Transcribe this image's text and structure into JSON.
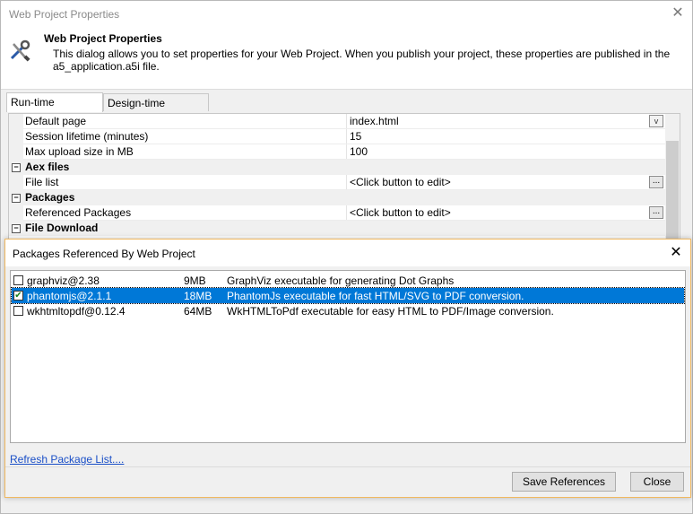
{
  "window": {
    "title": "Web Project Properties",
    "close_glyph": "✕"
  },
  "header": {
    "title": "Web Project Properties",
    "description_line1": "This dialog allows you to set properties for your Web Project. When you publish your project, these properties are published in the",
    "description_line2": "a5_application.a5i file.",
    "icon": "tools-icon"
  },
  "tabs": [
    {
      "label": "Run-time Properties",
      "active": true
    },
    {
      "label": "Design-time Properties",
      "active": false
    }
  ],
  "grid": {
    "rows": [
      {
        "type": "prop",
        "label": "Default page",
        "value": "index.html",
        "button": "dropdown"
      },
      {
        "type": "prop",
        "label": "Session lifetime (minutes)",
        "value": "15"
      },
      {
        "type": "prop",
        "label": "Max upload size in MB",
        "value": "100"
      },
      {
        "type": "category",
        "label": "Aex files"
      },
      {
        "type": "prop",
        "label": "File list",
        "value": "<Click button to edit>",
        "button": "ellipsis"
      },
      {
        "type": "category",
        "label": "Packages"
      },
      {
        "type": "prop",
        "label": "Referenced Packages",
        "value": "<Click button to edit>",
        "button": "ellipsis"
      },
      {
        "type": "category",
        "label": "File Download"
      }
    ],
    "ellipsis_glyph": "...",
    "dropdown_glyph": "v",
    "collapse_glyph": "−"
  },
  "modal": {
    "title": "Packages Referenced By Web Project",
    "close_glyph": "✕",
    "packages": [
      {
        "name": "graphviz@2.38",
        "size": "9MB",
        "description": "GraphViz executable for generating Dot Graphs",
        "checked": false,
        "selected": false
      },
      {
        "name": "phantomjs@2.1.1",
        "size": "18MB",
        "description": "PhantomJs executable for fast HTML/SVG to PDF conversion.",
        "checked": true,
        "selected": true
      },
      {
        "name": "wkhtmltopdf@0.12.4",
        "size": "64MB",
        "description": "WkHTMLToPdf executable for easy HTML to PDF/Image conversion.",
        "checked": false,
        "selected": false
      }
    ],
    "checkmark_glyph": "✔",
    "refresh_link": "Refresh Package List....",
    "save_button": "Save References",
    "close_button": "Close"
  },
  "colors": {
    "selection": "#0078d7",
    "link": "#1a4fc7",
    "modal_border": "#f0b860"
  }
}
